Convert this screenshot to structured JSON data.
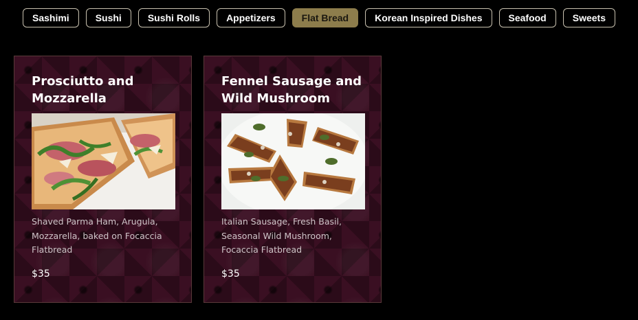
{
  "menu_tabs": [
    {
      "label": "Sashimi",
      "active": false
    },
    {
      "label": "Sushi",
      "active": false
    },
    {
      "label": "Sushi Rolls",
      "active": false
    },
    {
      "label": "Appetizers",
      "active": false
    },
    {
      "label": "Flat Bread",
      "active": true
    },
    {
      "label": "Korean Inspired Dishes",
      "active": false
    },
    {
      "label": "Seafood",
      "active": false
    },
    {
      "label": "Sweets",
      "active": false
    }
  ],
  "colors": {
    "active_tab": "#8d7d4c",
    "card_background": "#3a0f22",
    "card_border": "#5a3a3a"
  },
  "items": [
    {
      "title": "Prosciutto and Mozzarella",
      "image": "prosciutto-flatbread-photo",
      "description": "Shaved Parma Ham, Arugula, Mozzarella, baked on Focaccia Flatbread",
      "price": "$35"
    },
    {
      "title": "Fennel Sausage and Wild Mushroom",
      "image": "sausage-mushroom-flatbread-photo",
      "description": "Italian Sausage, Fresh Basil, Seasonal Wild Mushroom, Focaccia Flatbread",
      "price": "$35"
    }
  ]
}
